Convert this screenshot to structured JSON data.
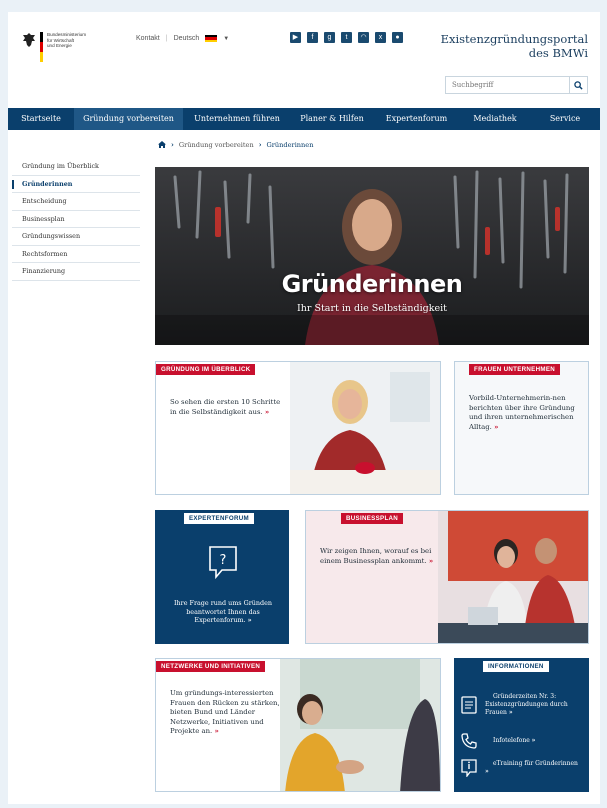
{
  "header": {
    "ministry_text": "Bundesministerium\nfür Wirtschaft\nund Energie",
    "contact_link": "Kontakt",
    "language": "Deutsch",
    "portal_title_line1": "Existenzgründungsportal",
    "portal_title_line2": "des BMWi",
    "search_placeholder": "Suchbegriff"
  },
  "social_icons": [
    "youtube-icon",
    "facebook-icon",
    "google-plus-icon",
    "twitter-icon",
    "rss-icon",
    "xing-icon",
    "app-icon"
  ],
  "nav": {
    "items": [
      "Startseite",
      "Gründung vorbereiten",
      "Unternehmen führen",
      "Planer & Hilfen",
      "Expertenforum",
      "Mediathek",
      "Service"
    ],
    "active_index": 1
  },
  "breadcrumb": {
    "items": [
      "Gründung vorbereiten",
      "Gründerinnen"
    ]
  },
  "sidebar": {
    "items": [
      "Gründung im Überblick",
      "Gründerinnen",
      "Entscheidung",
      "Businessplan",
      "Gründungswissen",
      "Rechtsformen",
      "Finanzierung"
    ],
    "active_index": 1
  },
  "hero": {
    "title": "Gründerinnen",
    "subtitle": "Ihr Start in die Selbständigkeit"
  },
  "cards": {
    "overview": {
      "tag": "GRÜNDUNG IM ÜBERBLICK",
      "text": "So sehen die ersten 10 Schritte in die Selbständigkeit aus."
    },
    "women": {
      "tag": "FRAUEN UNTERNEHMEN",
      "text": "Vorbild-Unternehmerin-nen berichten über ihre Gründung und ihren unternehmerischen Alltag."
    },
    "forum": {
      "tag": "EXPERTENFORUM",
      "text": "Ihre Frage rund ums Gründen beantwortet Ihnen das Expertenforum."
    },
    "businessplan": {
      "tag": "BUSINESSPLAN",
      "text": "Wir zeigen Ihnen, worauf es bei einem Businessplan ankommt."
    },
    "networks": {
      "tag": "NETZWERKE UND INITIATIVEN",
      "text": "Um gründungs-interessierten Frauen den Rücken zu stärken, bieten Bund und Länder Netzwerke, Initiativen und Projekte an."
    },
    "info": {
      "tag": "INFORMATIONEN",
      "items": [
        "Gründerzeiten Nr. 3: Existenzgründungen durch Frauen",
        "Infotelefone",
        "eTraining für Gründerinnen"
      ]
    }
  },
  "more_symbol": "»",
  "colors": {
    "navy": "#0a3f6c",
    "red": "#c8102e",
    "nav_active": "#1f5786"
  }
}
